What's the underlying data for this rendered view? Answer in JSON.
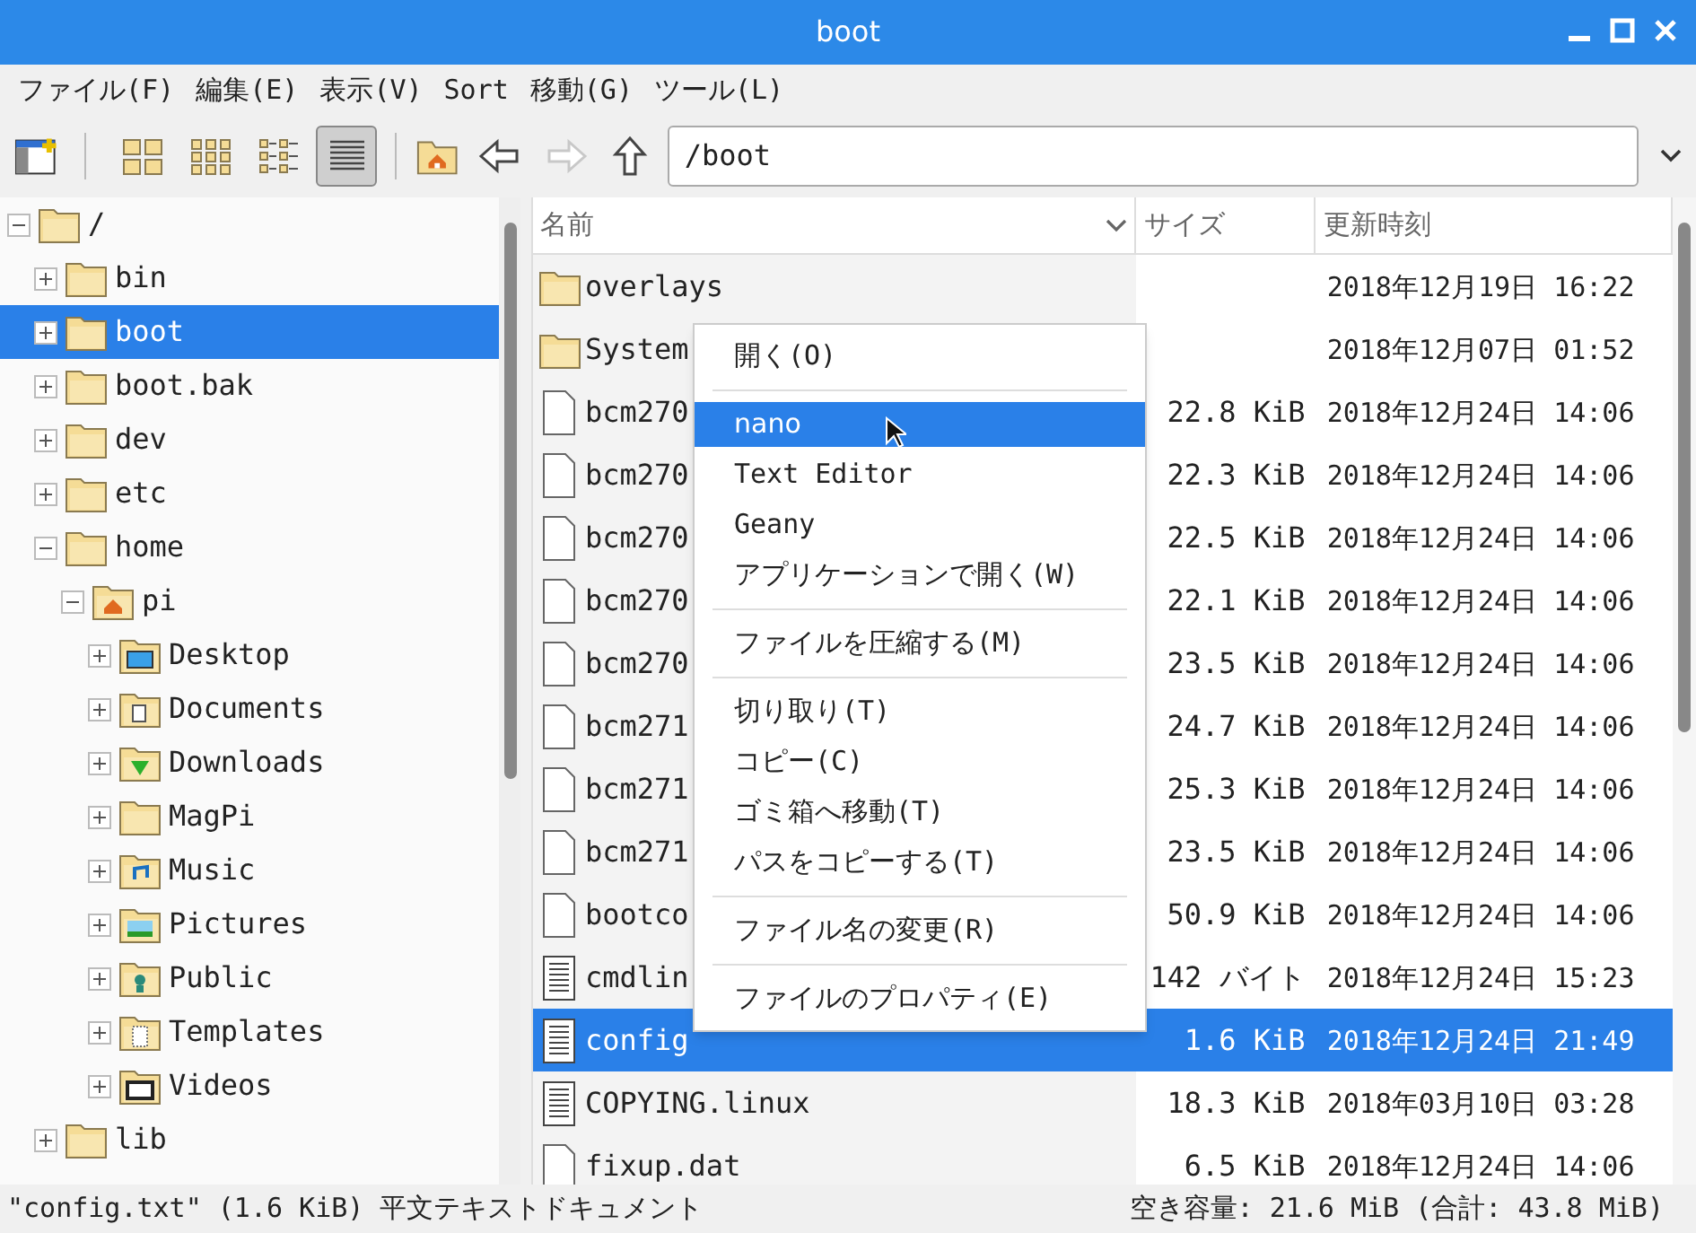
{
  "window": {
    "title": "boot"
  },
  "menu_bar": [
    "ファイル(F)",
    "編集(E)",
    "表示(V)",
    "Sort",
    "移動(G)",
    "ツール(L)"
  ],
  "view_modes": [
    {
      "selected": false
    },
    {
      "selected": false
    },
    {
      "selected": false
    },
    {
      "selected": true
    }
  ],
  "navigation": [
    {
      "disabled": false
    },
    {
      "disabled": true
    },
    {
      "disabled": false
    }
  ],
  "location": {
    "value": "/boot"
  },
  "tree": [
    {
      "label": "/",
      "kind": "folder",
      "expanded": true,
      "selected": false,
      "children": [
        {
          "label": "bin",
          "kind": "folder",
          "expanded": false,
          "selected": false
        },
        {
          "label": "boot",
          "kind": "folder",
          "expanded": false,
          "selected": true
        },
        {
          "label": "boot.bak",
          "kind": "folder",
          "expanded": false,
          "selected": false
        },
        {
          "label": "dev",
          "kind": "folder",
          "expanded": false,
          "selected": false
        },
        {
          "label": "etc",
          "kind": "folder",
          "expanded": false,
          "selected": false
        },
        {
          "label": "home",
          "kind": "folder",
          "expanded": true,
          "selected": false,
          "children": [
            {
              "label": "pi",
              "kind": "home",
              "expanded": true,
              "selected": false,
              "children": [
                {
                  "label": "Desktop",
                  "kind": "desktop",
                  "expanded": false,
                  "selected": false
                },
                {
                  "label": "Documents",
                  "kind": "documents",
                  "expanded": false,
                  "selected": false
                },
                {
                  "label": "Downloads",
                  "kind": "downloads",
                  "expanded": false,
                  "selected": false
                },
                {
                  "label": "MagPi",
                  "kind": "folder",
                  "expanded": false,
                  "selected": false
                },
                {
                  "label": "Music",
                  "kind": "music",
                  "expanded": false,
                  "selected": false
                },
                {
                  "label": "Pictures",
                  "kind": "pictures",
                  "expanded": false,
                  "selected": false
                },
                {
                  "label": "Public",
                  "kind": "public",
                  "expanded": false,
                  "selected": false
                },
                {
                  "label": "Templates",
                  "kind": "templates",
                  "expanded": false,
                  "selected": false
                },
                {
                  "label": "Videos",
                  "kind": "videos",
                  "expanded": false,
                  "selected": false
                }
              ]
            }
          ]
        },
        {
          "label": "lib",
          "kind": "folder",
          "expanded": false,
          "selected": false
        }
      ]
    }
  ],
  "file_list": {
    "columns": [
      "名前",
      "サイズ",
      "更新時刻"
    ],
    "rows": [
      {
        "name": "overlays",
        "kind": "folder",
        "size": "",
        "modified": "2018年12月19日 16:22",
        "selected": false
      },
      {
        "name": "System",
        "kind": "folder",
        "size": "",
        "modified": "2018年12月07日 01:52",
        "selected": false
      },
      {
        "name": "bcm270",
        "kind": "file",
        "size": "22.8 KiB",
        "modified": "2018年12月24日 14:06",
        "selected": false
      },
      {
        "name": "bcm270",
        "kind": "file",
        "size": "22.3 KiB",
        "modified": "2018年12月24日 14:06",
        "selected": false
      },
      {
        "name": "bcm270",
        "kind": "file",
        "size": "22.5 KiB",
        "modified": "2018年12月24日 14:06",
        "selected": false
      },
      {
        "name": "bcm270",
        "kind": "file",
        "size": "22.1 KiB",
        "modified": "2018年12月24日 14:06",
        "selected": false
      },
      {
        "name": "bcm270",
        "kind": "file",
        "size": "23.5 KiB",
        "modified": "2018年12月24日 14:06",
        "selected": false
      },
      {
        "name": "bcm271",
        "kind": "file",
        "size": "24.7 KiB",
        "modified": "2018年12月24日 14:06",
        "selected": false
      },
      {
        "name": "bcm271",
        "kind": "file",
        "size": "25.3 KiB",
        "modified": "2018年12月24日 14:06",
        "selected": false
      },
      {
        "name": "bcm271",
        "kind": "file",
        "size": "23.5 KiB",
        "modified": "2018年12月24日 14:06",
        "selected": false
      },
      {
        "name": "bootco",
        "kind": "file",
        "size": "50.9 KiB",
        "modified": "2018年12月24日 14:06",
        "selected": false
      },
      {
        "name": "cmdlin",
        "kind": "text",
        "size": "142 バイト",
        "modified": "2018年12月24日 15:23",
        "selected": false
      },
      {
        "name": "config",
        "kind": "text",
        "size": "1.6 KiB",
        "modified": "2018年12月24日 21:49",
        "selected": true
      },
      {
        "name": "COPYING.linux",
        "kind": "text",
        "size": "18.3 KiB",
        "modified": "2018年03月10日 03:28",
        "selected": false
      },
      {
        "name": "fixup.dat",
        "kind": "file",
        "size": "6.5 KiB",
        "modified": "2018年12月24日 14:06",
        "selected": false
      }
    ]
  },
  "context_menu": [
    {
      "kind": "item",
      "label": "開く(O)",
      "selected": false
    },
    {
      "kind": "separator"
    },
    {
      "kind": "item",
      "label": "nano",
      "selected": true
    },
    {
      "kind": "item",
      "label": "Text Editor",
      "selected": false
    },
    {
      "kind": "item",
      "label": "Geany",
      "selected": false
    },
    {
      "kind": "item",
      "label": "アプリケーションで開く(W)",
      "selected": false
    },
    {
      "kind": "separator"
    },
    {
      "kind": "item",
      "label": "ファイルを圧縮する(M)",
      "selected": false
    },
    {
      "kind": "separator"
    },
    {
      "kind": "item",
      "label": "切り取り(T)",
      "selected": false
    },
    {
      "kind": "item",
      "label": "コピー(C)",
      "selected": false
    },
    {
      "kind": "item",
      "label": "ゴミ箱へ移動(T)",
      "selected": false
    },
    {
      "kind": "item",
      "label": "パスをコピーする(T)",
      "selected": false
    },
    {
      "kind": "separator"
    },
    {
      "kind": "item",
      "label": "ファイル名の変更(R)",
      "selected": false
    },
    {
      "kind": "separator"
    },
    {
      "kind": "item",
      "label": "ファイルのプロパティ(E)",
      "selected": false
    }
  ],
  "status_bar": {
    "left": "\"config.txt\" (1.6 KiB) 平文テキストドキュメント",
    "right": "空き容量: 21.6 MiB (合計: 43.8 MiB)"
  }
}
